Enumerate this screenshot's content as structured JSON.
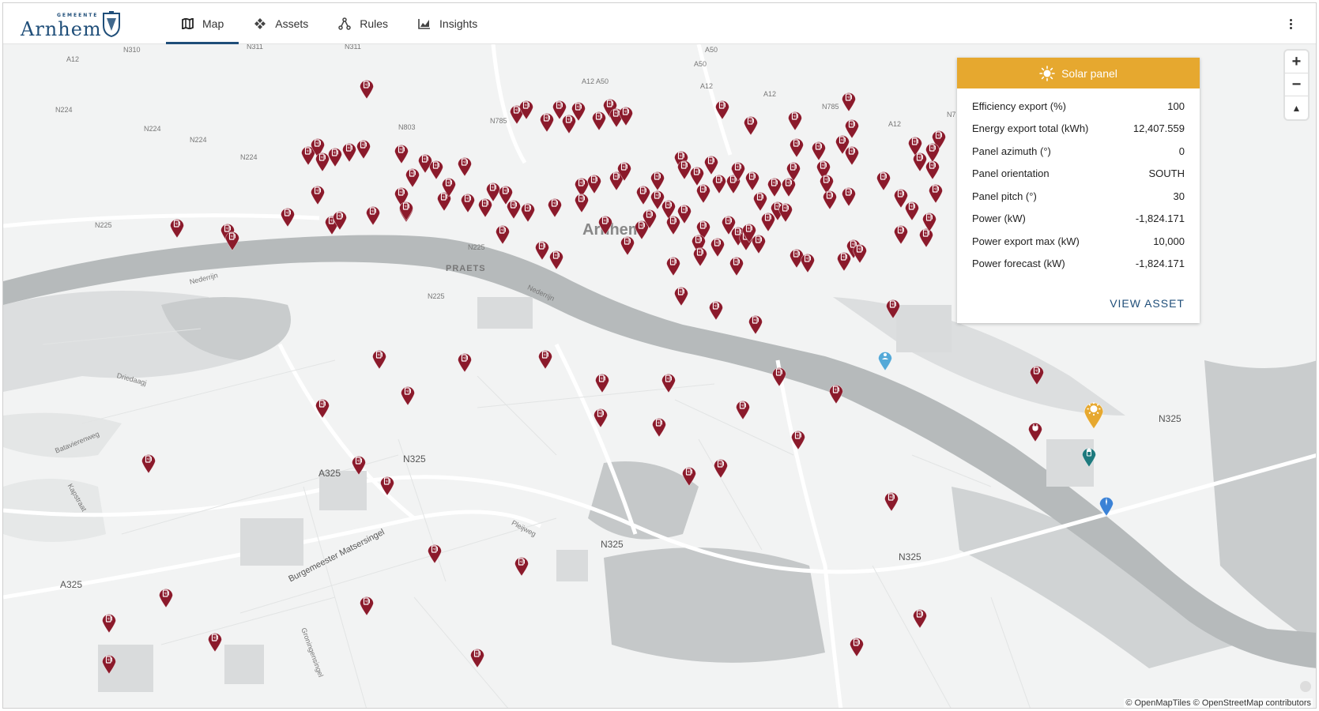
{
  "header": {
    "logo_small": "GEMEENTE",
    "logo_main": "Arnhem",
    "tabs": [
      {
        "label": "Map",
        "icon": "map-icon",
        "active": true
      },
      {
        "label": "Assets",
        "icon": "assets-icon",
        "active": false
      },
      {
        "label": "Rules",
        "icon": "rules-icon",
        "active": false
      },
      {
        "label": "Insights",
        "icon": "insights-icon",
        "active": false
      }
    ],
    "menu_icon": "more-vertical-icon"
  },
  "map": {
    "road_labels": [
      "A12",
      "N310",
      "N311",
      "N311",
      "A50",
      "A50",
      "A12",
      "A12 A50",
      "A12",
      "N224",
      "N224",
      "N224",
      "N224",
      "N803",
      "N785",
      "N785",
      "A12",
      "N7",
      "N225",
      "N225",
      "N225",
      "A325",
      "N325",
      "N325",
      "N325",
      "N325",
      "A325"
    ],
    "street_labels": [
      "Batavierenweg",
      "Driedaagj",
      "Kapstraat",
      "Burgemeester Matsersingel",
      "Pleijweg",
      "Groningensingel",
      "Nederrijn",
      "Nederrijn"
    ],
    "city_label": "Arnhem",
    "area_label": "PRAETS",
    "zoom_in": "+",
    "zoom_out": "−",
    "compass": "▲",
    "attribution": "© OpenMapTiles © OpenStreetMap contributors",
    "marker_types": {
      "charger": {
        "icon": "charger-icon",
        "color": "#8b1a2b"
      },
      "solar": {
        "icon": "sun-icon",
        "color": "#e6a82f"
      },
      "battery": {
        "icon": "battery-icon",
        "color": "#1e7a7e"
      },
      "wind": {
        "icon": "wind-icon",
        "color": "#3b82d6"
      },
      "building": {
        "icon": "building-icon",
        "color": "#54a9d8"
      },
      "plug": {
        "icon": "plug-icon",
        "color": "#8b1a2b"
      }
    }
  },
  "card": {
    "title": "Solar panel",
    "icon": "sun-icon",
    "accent": "#e6a82f",
    "rows": [
      {
        "label": "Efficiency export (%)",
        "value": "100"
      },
      {
        "label": "Energy export total (kWh)",
        "value": "12,407.559"
      },
      {
        "label": "Panel azimuth (°)",
        "value": "0"
      },
      {
        "label": "Panel orientation",
        "value": "SOUTH"
      },
      {
        "label": "Panel pitch (°)",
        "value": "30"
      },
      {
        "label": "Power (kW)",
        "value": "-1,824.171"
      },
      {
        "label": "Power export max (kW)",
        "value": "10,000"
      },
      {
        "label": "Power forecast (kW)",
        "value": "-1,824.171"
      }
    ],
    "action": "VIEW ASSET"
  }
}
